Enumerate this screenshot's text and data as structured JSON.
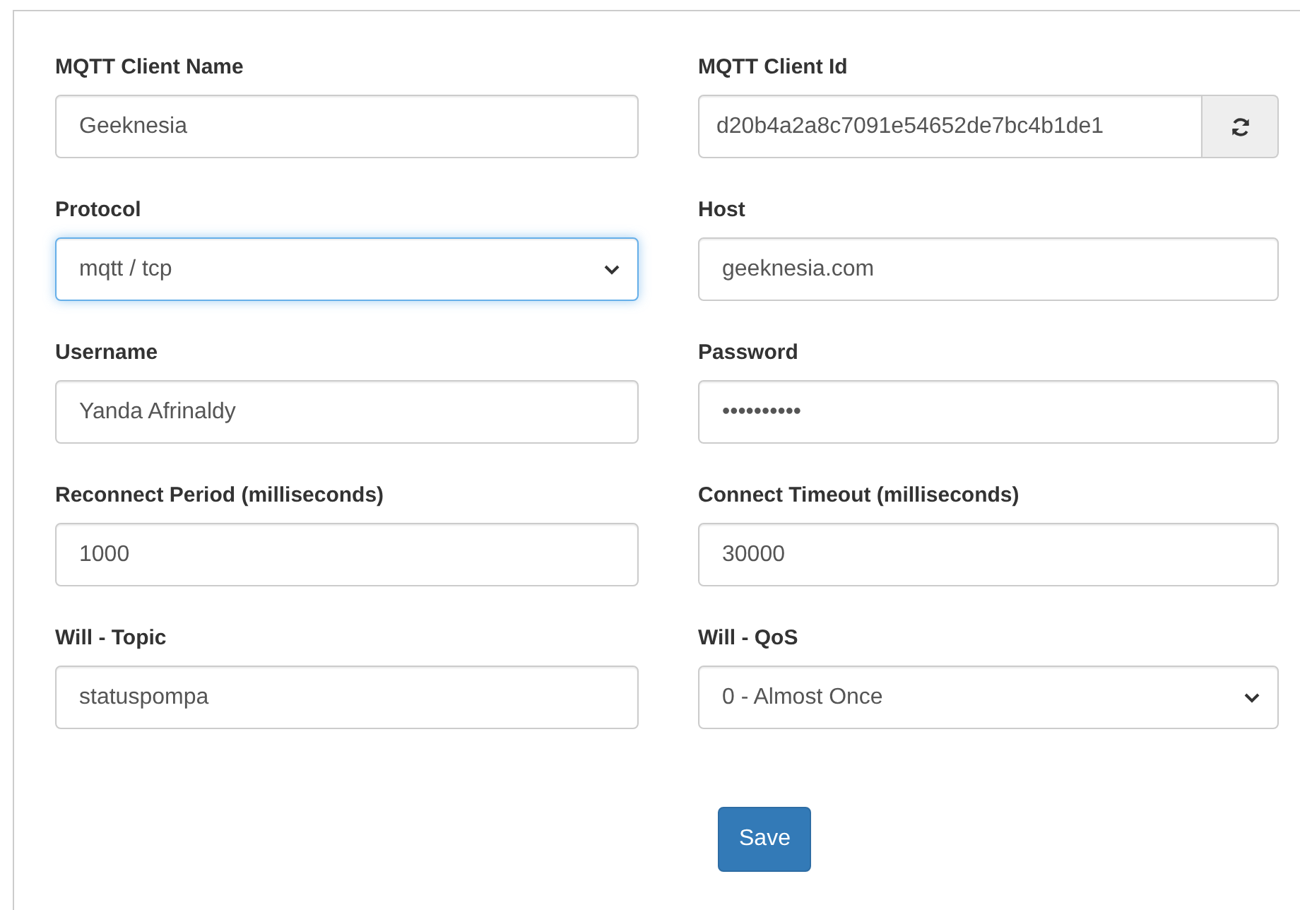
{
  "fields": [
    {
      "kind": "input",
      "label": "MQTT Client Name",
      "value": "Geeknesia",
      "focused": false
    },
    {
      "kind": "input-button",
      "label": "MQTT Client Id",
      "value": "d20b4a2a8c7091e54652de7bc4b1de1",
      "focused": false
    },
    {
      "kind": "select",
      "label": "Protocol",
      "value": "mqtt / tcp",
      "focused": true
    },
    {
      "kind": "input",
      "label": "Host",
      "value": "geeknesia.com",
      "focused": false
    },
    {
      "kind": "input",
      "label": "Username",
      "value": "Yanda Afrinaldy",
      "focused": false
    },
    {
      "kind": "input",
      "label": "Password",
      "value": "••••••••••",
      "focused": false
    },
    {
      "kind": "input",
      "label": "Reconnect Period (milliseconds)",
      "value": "1000",
      "focused": false
    },
    {
      "kind": "input",
      "label": "Connect Timeout (milliseconds)",
      "value": "30000",
      "focused": false
    },
    {
      "kind": "input",
      "label": "Will - Topic",
      "value": "statuspompa",
      "focused": false
    },
    {
      "kind": "select",
      "label": "Will - QoS",
      "value": "0 - Almost Once",
      "focused": false
    }
  ],
  "save_button": "Save"
}
